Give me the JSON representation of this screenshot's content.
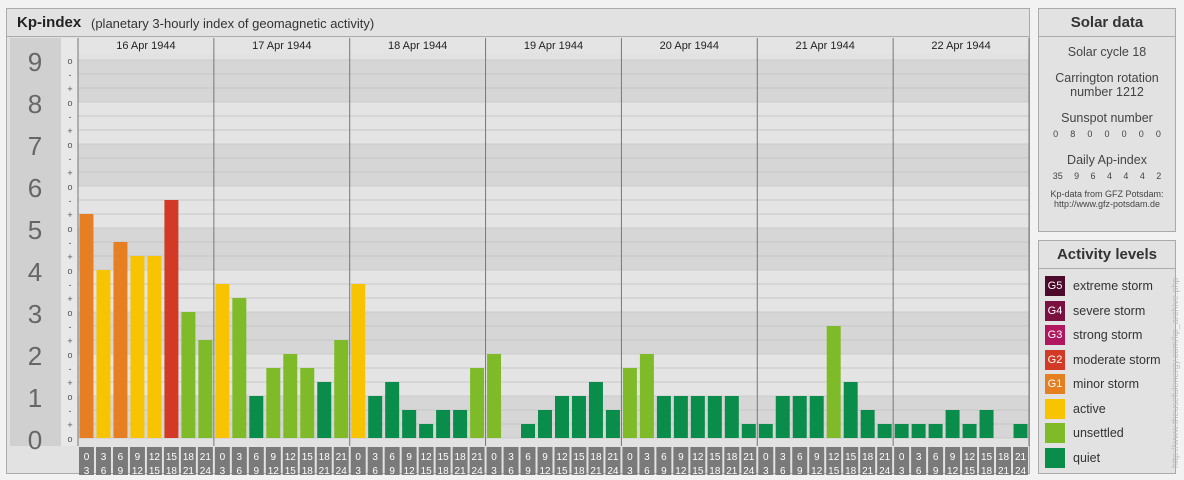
{
  "header": {
    "title": "Kp-index",
    "subtitle": "(planetary 3-hourly index of geomagnetic activity)"
  },
  "chart_data": {
    "type": "bar",
    "ylim": [
      0,
      9
    ],
    "y_ticks": [
      "0",
      "1",
      "2",
      "3",
      "4",
      "5",
      "6",
      "7",
      "8",
      "9"
    ],
    "minor_tick_labels": [
      "o",
      "+",
      "-",
      "o",
      "+",
      "-",
      "o",
      "+",
      "-",
      "o",
      "+",
      "-",
      "o",
      "+",
      "-",
      "o",
      "+",
      "-",
      "o",
      "+",
      "-",
      "o",
      "+",
      "-",
      "o",
      "+",
      "-",
      "o"
    ],
    "dates": [
      "16 Apr 1944",
      "17 Apr 1944",
      "18 Apr 1944",
      "19 Apr 1944",
      "20 Apr 1944",
      "21 Apr 1944",
      "22 Apr 1944"
    ],
    "interval_start": [
      "0",
      "3",
      "6",
      "9",
      "12",
      "15",
      "18",
      "21"
    ],
    "interval_end": [
      "3",
      "6",
      "9",
      "12",
      "15",
      "18",
      "21",
      "24"
    ],
    "values": [
      [
        5.333,
        4.0,
        4.667,
        4.333,
        4.333,
        5.667,
        3.0,
        2.333
      ],
      [
        3.667,
        3.333,
        1.0,
        1.667,
        2.0,
        1.667,
        1.333,
        2.333
      ],
      [
        3.667,
        1.0,
        1.333,
        0.667,
        0.333,
        0.667,
        0.667,
        1.667
      ],
      [
        2.0,
        0.0,
        0.333,
        0.667,
        1.0,
        1.0,
        1.333,
        0.667
      ],
      [
        1.667,
        2.0,
        1.0,
        1.0,
        1.0,
        1.0,
        1.0,
        0.333
      ],
      [
        0.333,
        1.0,
        1.0,
        1.0,
        2.667,
        1.333,
        0.667,
        0.333
      ],
      [
        0.333,
        0.333,
        0.333,
        0.667,
        0.333,
        0.667,
        0.0,
        0.333
      ]
    ],
    "colors": {
      "minor_storm": "#e67e22",
      "moderate_storm": "#d33a25",
      "active": "#f8c300",
      "unsettled": "#7fbb28",
      "quiet": "#0a8c4a"
    }
  },
  "solar": {
    "title": "Solar data",
    "cycle": "Solar cycle 18",
    "carrington_line1": "Carrington rotation",
    "carrington_line2": "number 1212",
    "sunspot_title": "Sunspot number",
    "sunspot_values": [
      "0",
      "8",
      "0",
      "0",
      "0",
      "0",
      "0"
    ],
    "ap_title": "Daily Ap-index",
    "ap_values": [
      "35",
      "9",
      "6",
      "4",
      "4",
      "4",
      "2"
    ],
    "source_line1": "Kp-data from GFZ Potsdam:",
    "source_line2": "http://www.gfz-potsdam.de"
  },
  "activity": {
    "title": "Activity levels",
    "levels": [
      {
        "code": "G5",
        "label": "extreme storm",
        "color": "#4b0a2a"
      },
      {
        "code": "G4",
        "label": "severe storm",
        "color": "#7a1040"
      },
      {
        "code": "G3",
        "label": "strong storm",
        "color": "#b0175e"
      },
      {
        "code": "G2",
        "label": "moderate storm",
        "color": "#d33a25"
      },
      {
        "code": "G1",
        "label": "minor storm",
        "color": "#e67e22"
      },
      {
        "code": "",
        "label": "active",
        "color": "#f8c300"
      },
      {
        "code": "",
        "label": "unsettled",
        "color": "#7fbb28"
      },
      {
        "code": "",
        "label": "quiet",
        "color": "#0a8c4a"
      }
    ]
  },
  "watermark": "http://www.theusefulenergy.com/kp_archive.php"
}
